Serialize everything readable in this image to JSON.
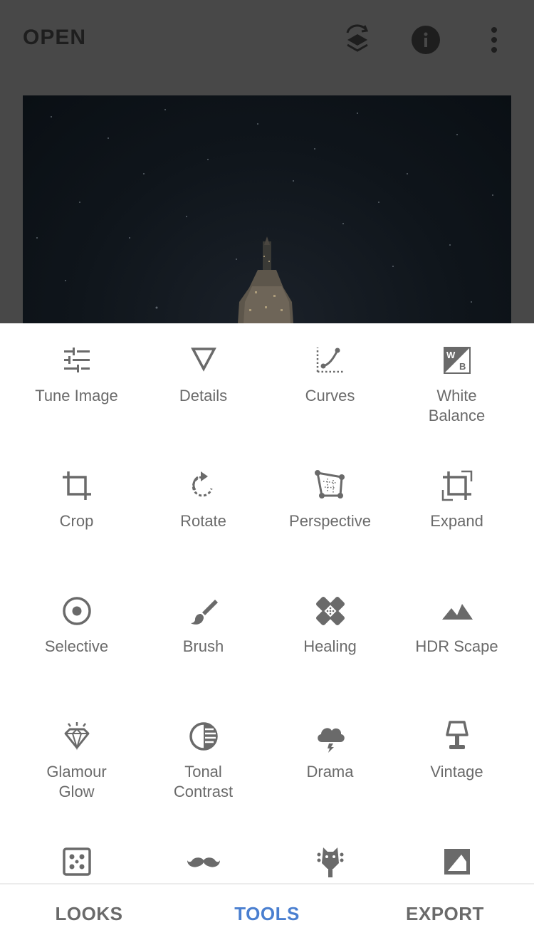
{
  "header": {
    "open_label": "OPEN",
    "icons": [
      "layers-stack-icon",
      "info-icon",
      "more-vertical-icon"
    ]
  },
  "tools": [
    {
      "label": "Tune Image",
      "icon": "tune-sliders-icon"
    },
    {
      "label": "Details",
      "icon": "details-triangle-icon"
    },
    {
      "label": "Curves",
      "icon": "curves-icon"
    },
    {
      "label": "White\nBalance",
      "icon": "white-balance-icon"
    },
    {
      "label": "Crop",
      "icon": "crop-icon"
    },
    {
      "label": "Rotate",
      "icon": "rotate-icon"
    },
    {
      "label": "Perspective",
      "icon": "perspective-icon"
    },
    {
      "label": "Expand",
      "icon": "expand-icon"
    },
    {
      "label": "Selective",
      "icon": "selective-target-icon"
    },
    {
      "label": "Brush",
      "icon": "brush-icon"
    },
    {
      "label": "Healing",
      "icon": "healing-bandage-icon"
    },
    {
      "label": "HDR Scape",
      "icon": "mountains-icon"
    },
    {
      "label": "Glamour\nGlow",
      "icon": "diamond-glow-icon"
    },
    {
      "label": "Tonal\nContrast",
      "icon": "tonal-contrast-icon"
    },
    {
      "label": "Drama",
      "icon": "storm-cloud-icon"
    },
    {
      "label": "Vintage",
      "icon": "lamp-icon"
    },
    {
      "label": "",
      "icon": "grainy-film-icon"
    },
    {
      "label": "",
      "icon": "mustache-icon"
    },
    {
      "label": "",
      "icon": "guitar-head-icon"
    },
    {
      "label": "",
      "icon": "frame-icon"
    }
  ],
  "bottom_nav": {
    "tabs": [
      {
        "label": "LOOKS",
        "active": false
      },
      {
        "label": "TOOLS",
        "active": true
      },
      {
        "label": "EXPORT",
        "active": false
      }
    ]
  },
  "colors": {
    "accent": "#4a7fd0",
    "icon": "#6a6a6a",
    "dim_overlay": "#484848"
  }
}
